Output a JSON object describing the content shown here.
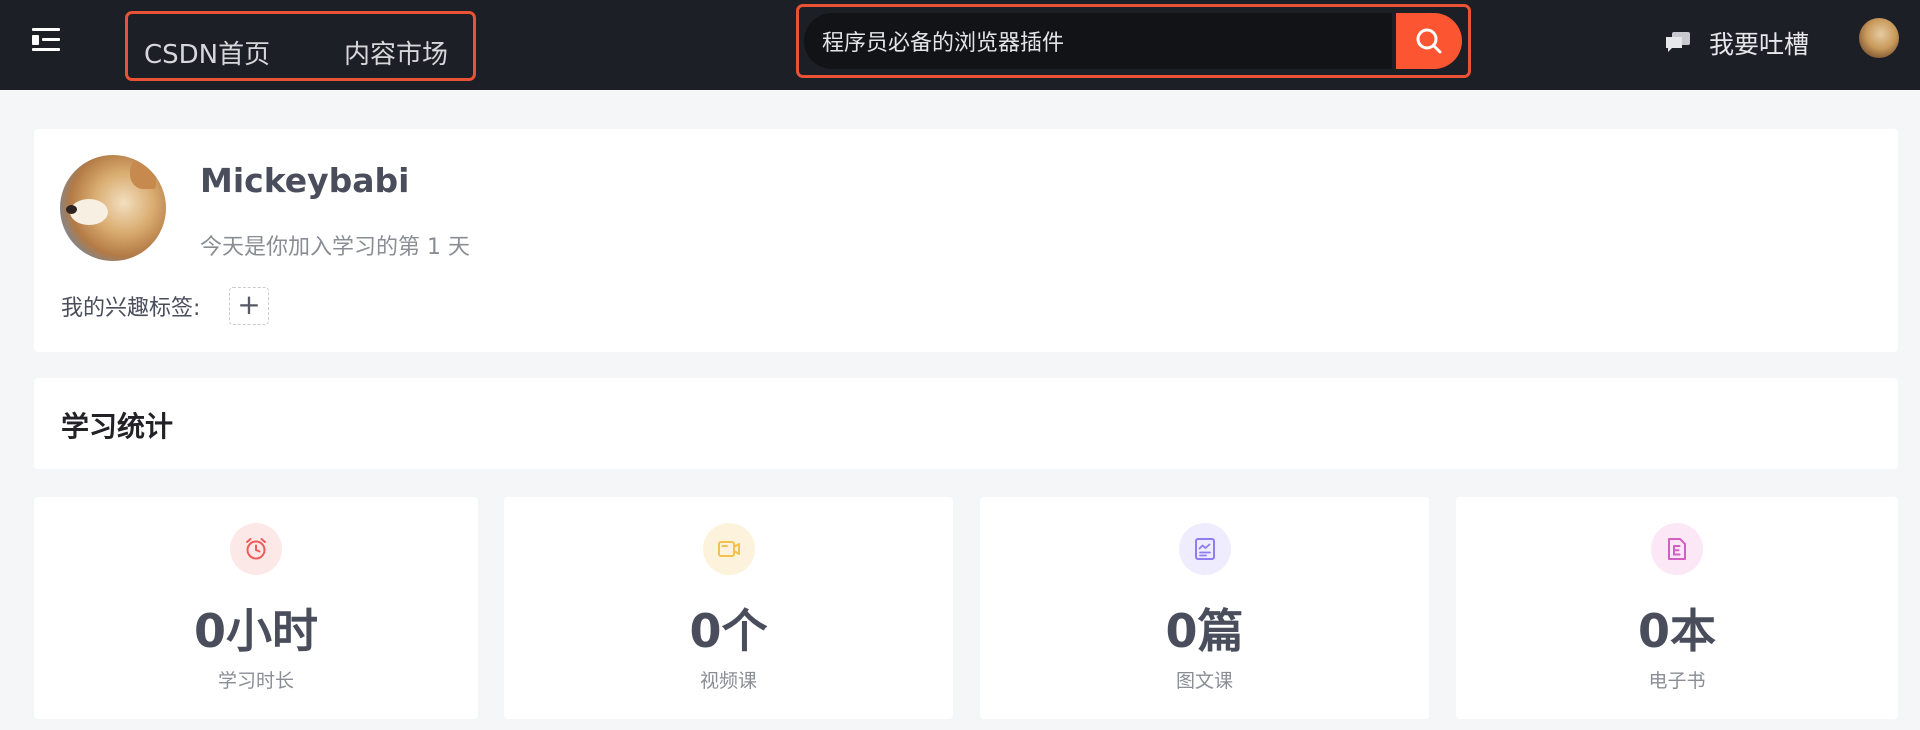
{
  "header": {
    "nav": [
      {
        "label": "CSDN首页"
      },
      {
        "label": "内容市场"
      }
    ],
    "search": {
      "value": "程序员必备的浏览器插件",
      "placeholder": "",
      "icon": "search-icon"
    },
    "feedback_label": "我要吐槽",
    "feedback_icon": "chat-bubble-icon"
  },
  "profile": {
    "username": "Mickeybabi",
    "join_text": "今天是你加入学习的第 1 天",
    "tags_label": "我的兴趣标签:",
    "add_tag_symbol": "+"
  },
  "stats": {
    "title": "学习统计",
    "items": [
      {
        "value": "0小时",
        "label": "学习时长",
        "icon": "alarm-clock-icon",
        "color": "#f25b5b",
        "bg": "#fde8e8"
      },
      {
        "value": "0个",
        "label": "视频课",
        "icon": "video-icon",
        "color": "#f2c14e",
        "bg": "#fdf3dc"
      },
      {
        "value": "0篇",
        "label": "图文课",
        "icon": "image-text-icon",
        "color": "#8e7cf0",
        "bg": "#efecfd"
      },
      {
        "value": "0本",
        "label": "电子书",
        "icon": "ebook-icon",
        "color": "#d45fc4",
        "bg": "#fbe7f6"
      }
    ]
  },
  "colors": {
    "topbar_bg": "#1d1f27",
    "accent": "#fc5531",
    "highlight_border": "#e95234",
    "page_bg": "#f5f6f7"
  }
}
